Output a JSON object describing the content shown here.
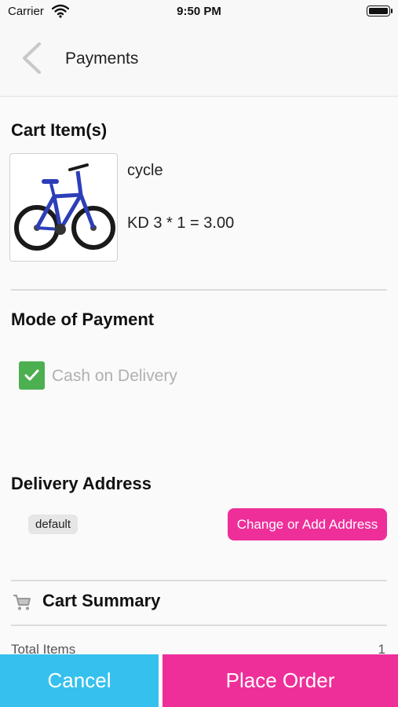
{
  "status_bar": {
    "carrier": "Carrier",
    "time": "9:50 PM"
  },
  "nav": {
    "title": "Payments"
  },
  "cart": {
    "title": "Cart Item(s)",
    "item": {
      "name": "cycle",
      "price_line": "KD 3 * 1 = 3.00"
    }
  },
  "payment": {
    "title": "Mode of Payment",
    "option_label": "Cash on Delivery",
    "checked": true
  },
  "delivery": {
    "title": "Delivery Address",
    "address_tag": "default",
    "change_button": "Change or Add Address"
  },
  "summary": {
    "title": "Cart Summary",
    "total_items_label": "Total Items",
    "total_items_value": "1"
  },
  "actions": {
    "cancel": "Cancel",
    "place_order": "Place Order"
  },
  "colors": {
    "accent_pink": "#ee2f9a",
    "accent_blue": "#35c0ee",
    "check_green": "#4caf50"
  },
  "icons": {
    "back": "chevron-left-icon",
    "wifi": "wifi-icon",
    "battery": "battery-icon",
    "check": "checkmark-icon",
    "cart": "shopping-cart-icon"
  }
}
